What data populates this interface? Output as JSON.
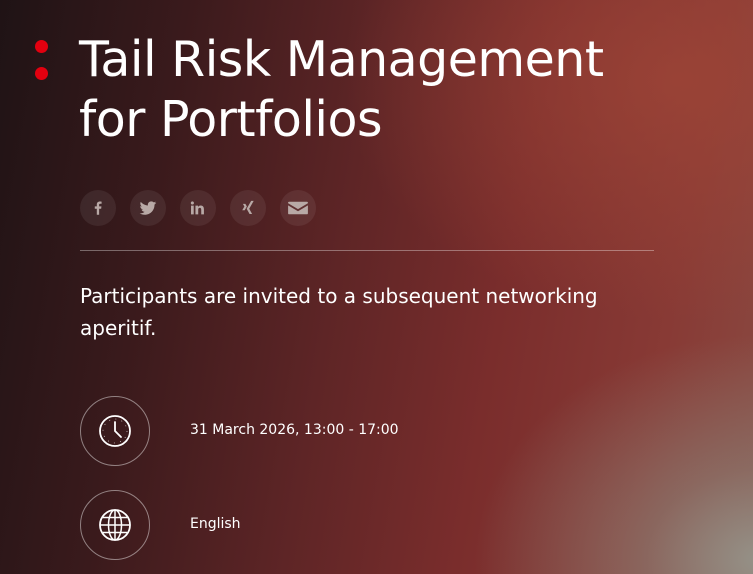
{
  "event": {
    "title_line1": "Tail Risk Management",
    "title_line2": "for Portfolios",
    "intro": "Participants are invited to a subsequent networking aperitif.",
    "date_time": "31 March 2026, 13:00 - 17:00",
    "language": "English"
  },
  "share": {
    "icons": [
      "facebook-icon",
      "twitter-icon",
      "linkedin-icon",
      "xing-icon",
      "email-icon"
    ]
  },
  "colors": {
    "accent_red": "#e3000f",
    "text": "#ffffff"
  }
}
